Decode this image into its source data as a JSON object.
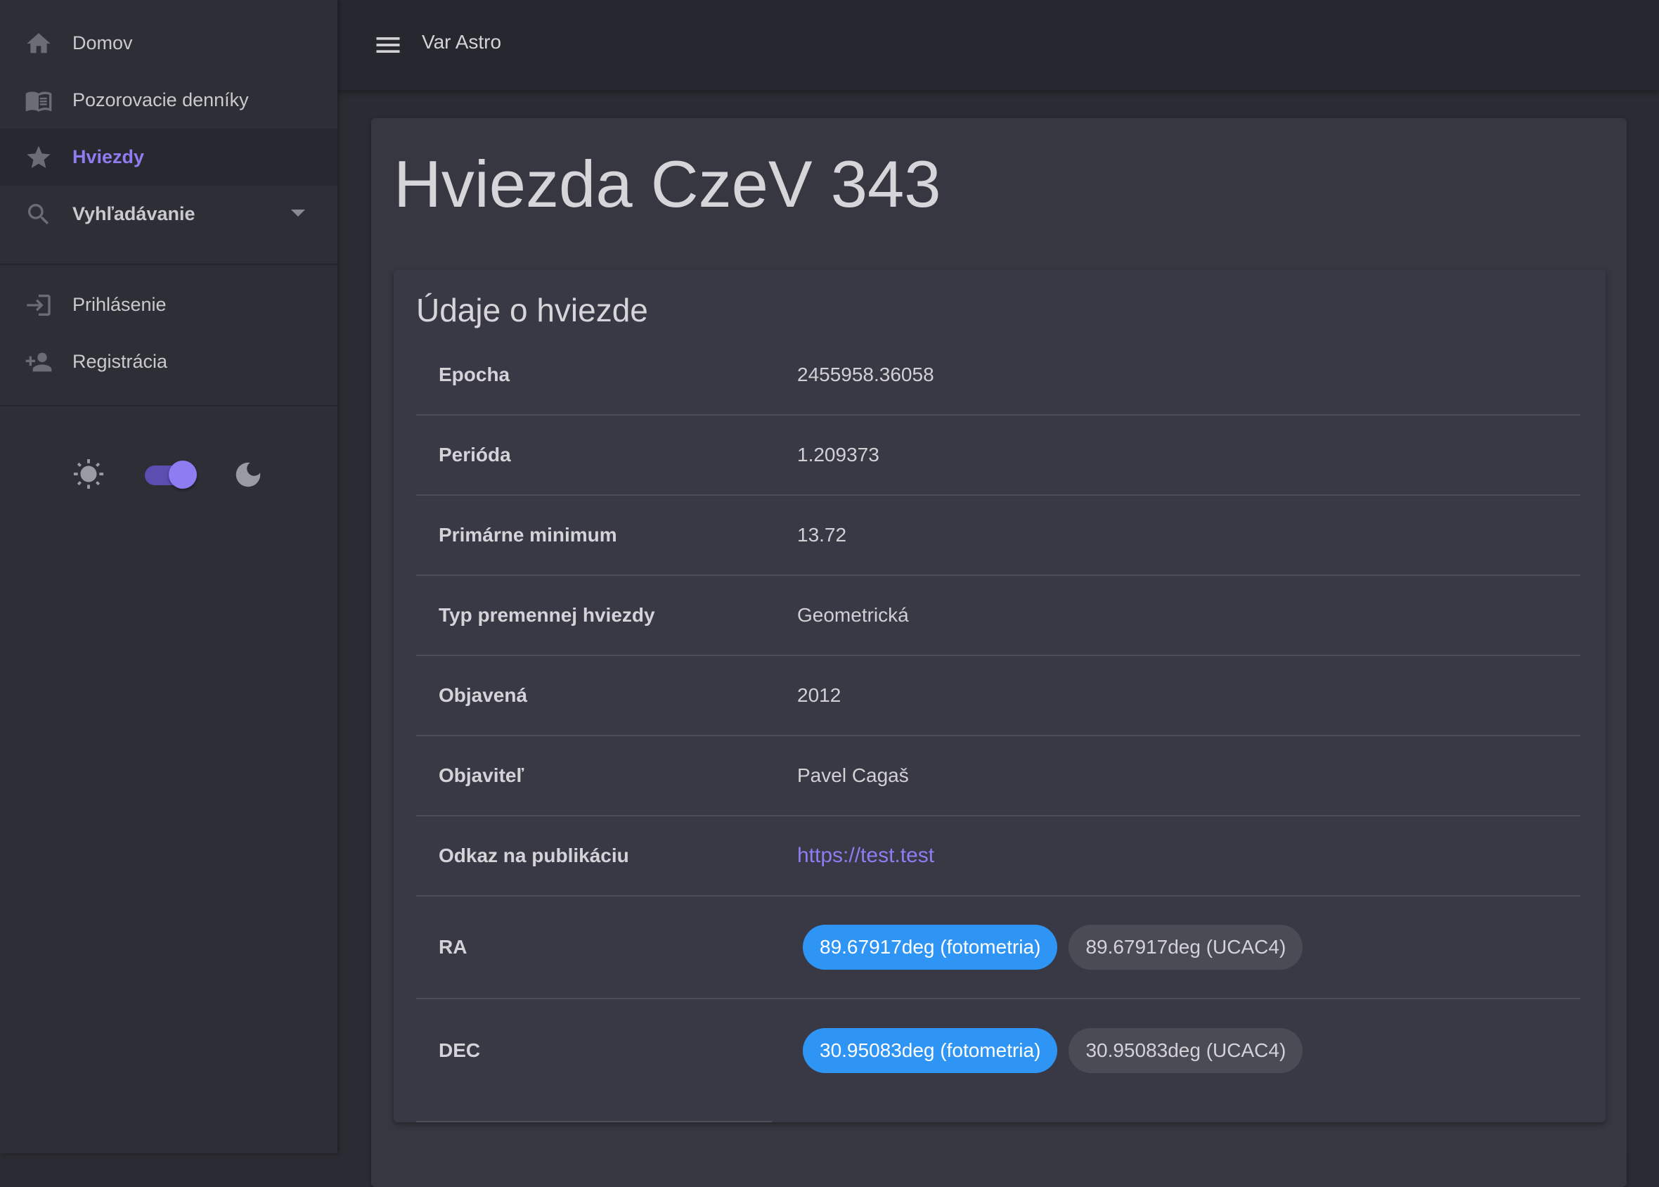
{
  "sidebar": {
    "items": [
      {
        "label": "Domov",
        "icon": "home-icon"
      },
      {
        "label": "Pozorovacie denníky",
        "icon": "book-icon"
      },
      {
        "label": "Hviezdy",
        "icon": "star-icon",
        "active": true
      },
      {
        "label": "Vyhľadávanie",
        "icon": "search-icon",
        "expandable": true
      }
    ],
    "auth_items": [
      {
        "label": "Prihlásenie",
        "icon": "login-icon"
      },
      {
        "label": "Registrácia",
        "icon": "person-add-icon"
      }
    ],
    "theme": {
      "mode": "dark",
      "light_icon": "sun-icon",
      "dark_icon": "moon-icon",
      "toggle_on": true
    }
  },
  "appbar": {
    "title": "Var Astro",
    "menu_icon": "menu-icon"
  },
  "page": {
    "title": "Hviezda CzeV 343",
    "section_title": "Údaje o hviezde"
  },
  "star_info": {
    "rows": [
      {
        "label": "Epocha",
        "value": "2455958.36058"
      },
      {
        "label": "Perióda",
        "value": "1.209373"
      },
      {
        "label": "Primárne minimum",
        "value": "13.72"
      },
      {
        "label": "Typ premennej hviezdy",
        "value": "Geometrická"
      },
      {
        "label": "Objavená",
        "value": "2012"
      },
      {
        "label": "Objaviteľ",
        "value": "Pavel Cagaš"
      },
      {
        "label": "Odkaz na publikáciu",
        "value": "https://test.test"
      }
    ],
    "ra": {
      "label": "RA",
      "chips": [
        "89.67917deg (fotometria)",
        "89.67917deg (UCAC4)"
      ]
    },
    "dec": {
      "label": "DEC",
      "chips": [
        "30.95083deg (fotometria)",
        "30.95083deg (UCAC4)"
      ]
    }
  },
  "colors": {
    "accent": "#8d7df2",
    "chip_primary": "#2f95f4",
    "background": "#2b2c33"
  }
}
